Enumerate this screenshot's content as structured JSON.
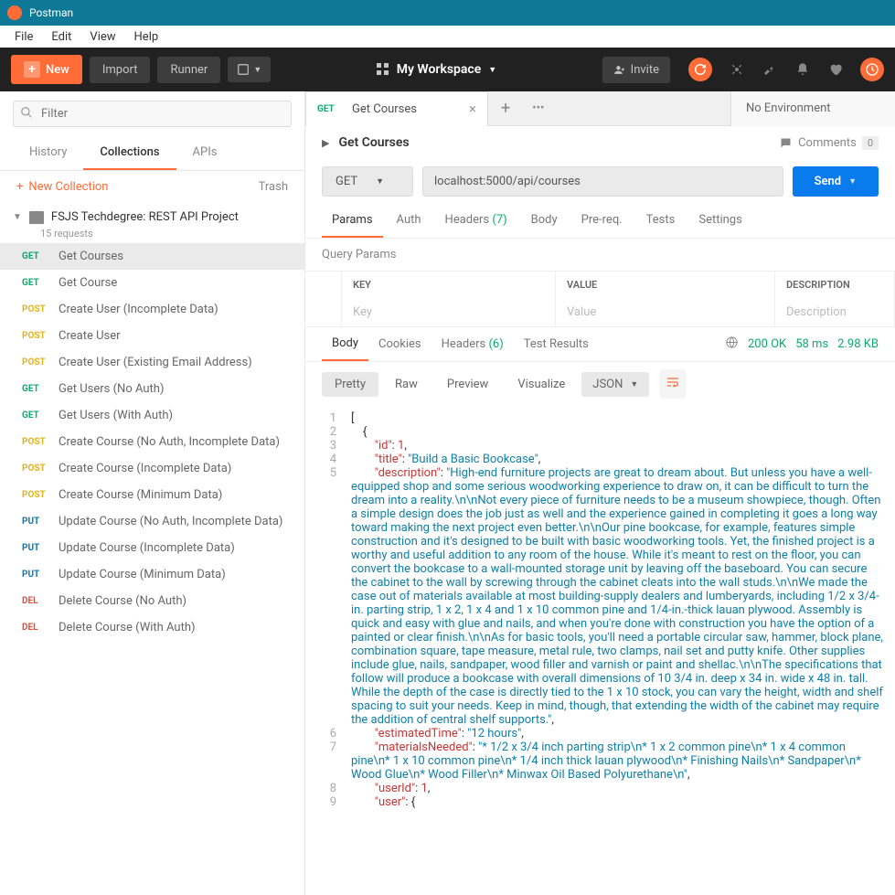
{
  "app_title": "Postman",
  "menu": [
    "File",
    "Edit",
    "View",
    "Help"
  ],
  "topbar": {
    "new": "New",
    "import": "Import",
    "runner": "Runner",
    "workspace": "My Workspace",
    "invite": "Invite"
  },
  "sidebar": {
    "filter_placeholder": "Filter",
    "tabs": [
      "History",
      "Collections",
      "APIs"
    ],
    "active_tab": "Collections",
    "new_collection": "New Collection",
    "trash": "Trash",
    "collection": {
      "name": "FSJS Techdegree: REST API Project",
      "sub": "15 requests"
    },
    "requests": [
      {
        "method": "GET",
        "cls": "m-get",
        "name": "Get Courses",
        "active": true
      },
      {
        "method": "GET",
        "cls": "m-get",
        "name": "Get Course"
      },
      {
        "method": "POST",
        "cls": "m-post",
        "name": "Create User (Incomplete Data)"
      },
      {
        "method": "POST",
        "cls": "m-post",
        "name": "Create User"
      },
      {
        "method": "POST",
        "cls": "m-post",
        "name": "Create User (Existing Email Address)"
      },
      {
        "method": "GET",
        "cls": "m-get",
        "name": "Get Users (No Auth)"
      },
      {
        "method": "GET",
        "cls": "m-get",
        "name": "Get Users (With Auth)"
      },
      {
        "method": "POST",
        "cls": "m-post",
        "name": "Create Course (No Auth, Incomplete Data)"
      },
      {
        "method": "POST",
        "cls": "m-post",
        "name": "Create Course (Incomplete Data)"
      },
      {
        "method": "POST",
        "cls": "m-post",
        "name": "Create Course (Minimum Data)"
      },
      {
        "method": "PUT",
        "cls": "m-put",
        "name": "Update Course (No Auth, Incomplete Data)"
      },
      {
        "method": "PUT",
        "cls": "m-put",
        "name": "Update Course (Incomplete Data)"
      },
      {
        "method": "PUT",
        "cls": "m-put",
        "name": "Update Course (Minimum Data)"
      },
      {
        "method": "DEL",
        "cls": "m-del",
        "name": "Delete Course (No Auth)"
      },
      {
        "method": "DEL",
        "cls": "m-del",
        "name": "Delete Course (With Auth)"
      }
    ]
  },
  "tab": {
    "method": "GET",
    "name": "Get Courses"
  },
  "env": "No Environment",
  "request": {
    "title": "Get Courses",
    "method": "GET",
    "url": "localhost:5000/api/courses",
    "send": "Send",
    "comments": "Comments",
    "comments_count": "0"
  },
  "req_tabs": {
    "params": "Params",
    "auth": "Auth",
    "headers": "Headers",
    "headers_count": "(7)",
    "body": "Body",
    "prereq": "Pre-req.",
    "tests": "Tests",
    "settings": "Settings"
  },
  "qp": {
    "title": "Query Params",
    "key": "KEY",
    "value": "VALUE",
    "desc": "DESCRIPTION",
    "key_ph": "Key",
    "val_ph": "Value",
    "desc_ph": "Description"
  },
  "resp_tabs": {
    "body": "Body",
    "cookies": "Cookies",
    "headers": "Headers",
    "headers_count": "(6)",
    "test": "Test Results"
  },
  "resp": {
    "status": "200 OK",
    "time": "58 ms",
    "size": "2.98 KB"
  },
  "view": {
    "pretty": "Pretty",
    "raw": "Raw",
    "preview": "Preview",
    "visualize": "Visualize",
    "format": "JSON"
  },
  "json_body": {
    "id": 1,
    "title": "Build a Basic Bookcase",
    "description": "High-end furniture projects are great to dream about. But unless you have a well-equipped shop and some serious woodworking experience to draw on, it can be difficult to turn the dream into a reality.\\n\\nNot every piece of furniture needs to be a museum showpiece, though. Often a simple design does the job just as well and the experience gained in completing it goes a long way toward making the next project even better.\\n\\nOur pine bookcase, for example, features simple construction and it's designed to be built with basic woodworking tools. Yet, the finished project is a worthy and useful addition to any room of the house. While it's meant to rest on the floor, you can convert the bookcase to a wall-mounted storage unit by leaving off the baseboard. You can secure the cabinet to the wall by screwing through the cabinet cleats into the wall studs.\\n\\nWe made the case out of materials available at most building-supply dealers and lumberyards, including 1/2 x 3/4-in. parting strip, 1 x 2, 1 x 4 and 1 x 10 common pine and 1/4-in.-thick lauan plywood. Assembly is quick and easy with glue and nails, and when you're done with construction you have the option of a painted or clear finish.\\n\\nAs for basic tools, you'll need a portable circular saw, hammer, block plane, combination square, tape measure, metal rule, two clamps, nail set and putty knife. Other supplies include glue, nails, sandpaper, wood filler and varnish or paint and shellac.\\n\\nThe specifications that follow will produce a bookcase with overall dimensions of 10 3/4 in. deep x 34 in. wide x 48 in. tall. While the depth of the case is directly tied to the 1 x 10 stock, you can vary the height, width and shelf spacing to suit your needs. Keep in mind, though, that extending the width of the cabinet may require the addition of central shelf supports.",
    "estimatedTime": "12 hours",
    "materialsNeeded": "* 1/2 x 3/4 inch parting strip\\n* 1 x 2 common pine\\n* 1 x 4 common pine\\n* 1 x 10 common pine\\n* 1/4 inch thick lauan plywood\\n* Finishing Nails\\n* Sandpaper\\n* Wood Glue\\n* Wood Filler\\n* Minwax Oil Based Polyurethane\\n",
    "userId": 1
  }
}
